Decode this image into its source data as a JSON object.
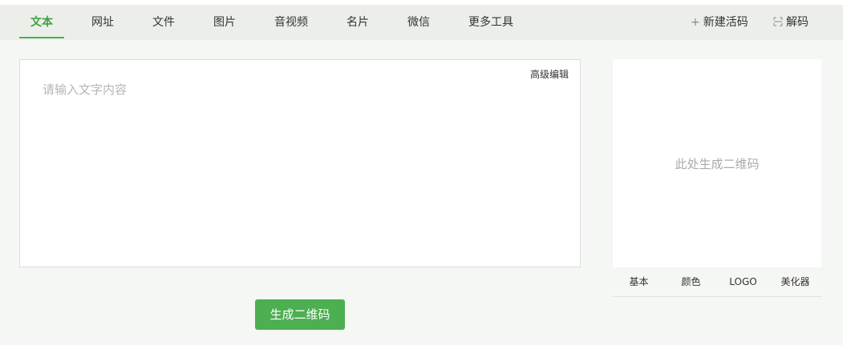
{
  "nav": {
    "tabs": [
      {
        "label": "文本",
        "active": true
      },
      {
        "label": "网址",
        "active": false
      },
      {
        "label": "文件",
        "active": false
      },
      {
        "label": "图片",
        "active": false
      },
      {
        "label": "音视频",
        "active": false
      },
      {
        "label": "名片",
        "active": false
      },
      {
        "label": "微信",
        "active": false
      },
      {
        "label": "更多工具",
        "active": false
      }
    ],
    "new_live_code": {
      "icon": "plus-icon",
      "label": "新建活码"
    },
    "decode": {
      "icon": "scan-icon",
      "label": "解码"
    }
  },
  "editor": {
    "placeholder": "请输入文字内容",
    "value": "",
    "advanced_edit_label": "高级编辑"
  },
  "generate_button_label": "生成二维码",
  "qr_panel": {
    "placeholder": "此处生成二维码",
    "tabs": [
      "基本",
      "颜色",
      "LOGO",
      "美化器"
    ]
  },
  "colors": {
    "accent": "#4caf50",
    "nav_background": "#ecefe9",
    "page_background": "#f5f7f4"
  }
}
